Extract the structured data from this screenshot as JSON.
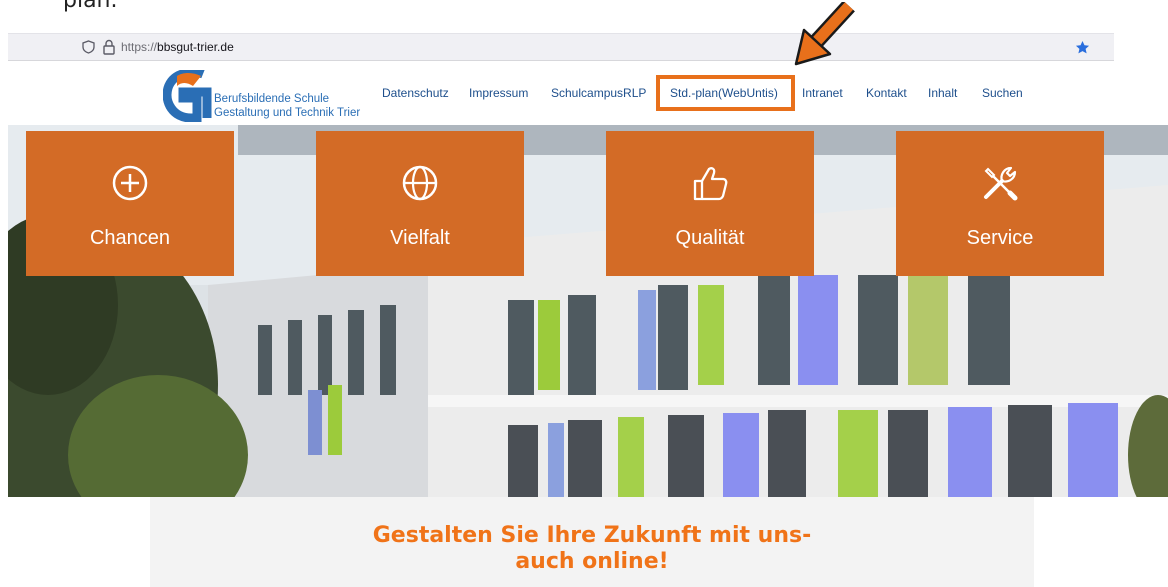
{
  "caption": "plan.",
  "browser": {
    "url_scheme": "https://",
    "url_host": "bbsgut-trier.de",
    "icons": [
      "shield-icon",
      "lock-icon",
      "bookmark-star-icon"
    ],
    "star_color": "#2a6edd"
  },
  "site": {
    "logo": {
      "line1": "Berufsbildende Schule",
      "line2": "Gestaltung und Technik Trier"
    },
    "nav": [
      {
        "label": "Datenschutz"
      },
      {
        "label": "Impressum"
      },
      {
        "label": "SchulcampusRLP"
      },
      {
        "label": "Std.-plan(WebUntis)",
        "highlighted": true
      },
      {
        "label": "Intranet"
      },
      {
        "label": "Kontakt"
      },
      {
        "label": "Inhalt"
      },
      {
        "label": "Suchen"
      }
    ],
    "tiles": [
      {
        "label": "Chancen",
        "icon": "plus-circle-icon"
      },
      {
        "label": "Vielfalt",
        "icon": "globe-icon"
      },
      {
        "label": "Qualität",
        "icon": "thumbs-up-icon"
      },
      {
        "label": "Service",
        "icon": "tools-icon"
      }
    ],
    "tagline_line1": "Gestalten Sie Ihre Zukunft mit uns-",
    "tagline_line2": "auch online!"
  },
  "colors": {
    "accent_orange": "#e8701b",
    "tile_orange": "#d36b26",
    "nav_blue": "#1e4f8c",
    "tagline_orange": "#f07318"
  }
}
